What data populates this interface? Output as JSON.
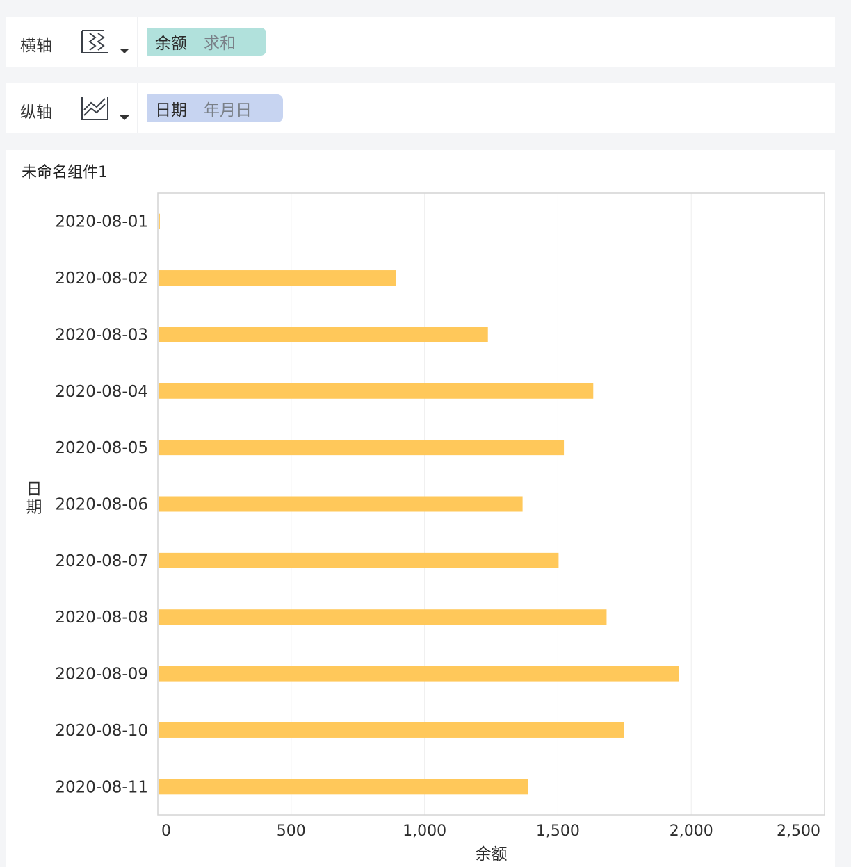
{
  "x_axis_row": {
    "label": "横轴",
    "chart_icon": "bar-horizontal-chart-icon",
    "field": "余额",
    "aggregation": "求和",
    "pill_color": "#b1e1dc"
  },
  "y_axis_row": {
    "label": "纵轴",
    "chart_icon": "line-area-chart-icon",
    "field": "日期",
    "aggregation": "年月日",
    "pill_color": "#c7d4f1"
  },
  "widget": {
    "title": "未命名组件1"
  },
  "chart_data": {
    "type": "bar",
    "orientation": "horizontal",
    "xlabel": "余额",
    "ylabel": "日期",
    "xlim": [
      0,
      2500
    ],
    "xticks": [
      0,
      500,
      1000,
      1500,
      2000,
      2500
    ],
    "xtick_labels": [
      "0",
      "500",
      "1,000",
      "1,500",
      "2,000",
      "2,500"
    ],
    "categories": [
      "2020-08-01",
      "2020-08-02",
      "2020-08-03",
      "2020-08-04",
      "2020-08-05",
      "2020-08-06",
      "2020-08-07",
      "2020-08-08",
      "2020-08-09",
      "2020-08-10",
      "2020-08-11"
    ],
    "values": [
      5,
      890,
      1235,
      1630,
      1520,
      1365,
      1500,
      1680,
      1950,
      1745,
      1385
    ],
    "bar_color": "#ffc85a",
    "grid": true
  }
}
